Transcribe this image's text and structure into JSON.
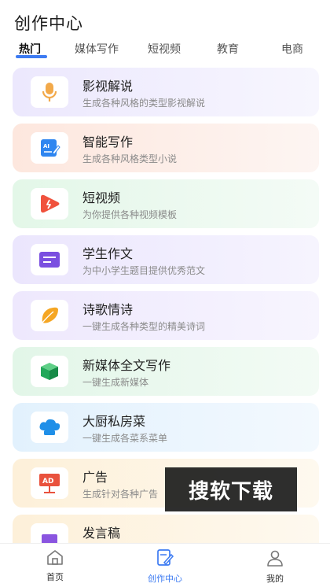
{
  "header": {
    "title": "创作中心"
  },
  "tabs": [
    {
      "label": "热门",
      "active": true
    },
    {
      "label": "媒体写作",
      "active": false
    },
    {
      "label": "短视频",
      "active": false
    },
    {
      "label": "教育",
      "active": false
    },
    {
      "label": "电商",
      "active": false
    }
  ],
  "cards": [
    {
      "title": "影视解说",
      "subtitle": "生成各种风格的类型影视解说",
      "icon": "microphone-icon",
      "bg": "#f1eefd",
      "accent": "#f2a94a"
    },
    {
      "title": "智能写作",
      "subtitle": "生成各种风格类型小说",
      "icon": "ai-write-icon",
      "bg": "#fdeee7",
      "accent": "#2f86f0"
    },
    {
      "title": "短视频",
      "subtitle": "为你提供各种视频模板",
      "icon": "video-play-icon",
      "bg": "#e9f8ee",
      "accent": "#f0523d"
    },
    {
      "title": "学生作文",
      "subtitle": "为中小学生题目提供优秀范文",
      "icon": "essay-icon",
      "bg": "#efeafd",
      "accent": "#7a4fe0"
    },
    {
      "title": "诗歌情诗",
      "subtitle": "一键生成各种类型的精美诗词",
      "icon": "leaf-icon",
      "bg": "#f1ecfd",
      "accent": "#f5a623"
    },
    {
      "title": "新媒体全文写作",
      "subtitle": "一键生成新媒体",
      "icon": "cube-icon",
      "bg": "#e8f7ec",
      "accent": "#22a85a"
    },
    {
      "title": "大厨私房菜",
      "subtitle": "一键生成各菜系菜单",
      "icon": "chef-hat-icon",
      "bg": "#e8f4fd",
      "accent": "#1f8fe8"
    },
    {
      "title": "广告",
      "subtitle": "生成针对各种广告",
      "icon": "ad-sign-icon",
      "bg": "#fdf3e1",
      "accent": "#e9523d"
    },
    {
      "title": "发言稿",
      "subtitle": "",
      "icon": "speech-icon",
      "bg": "#fdf3e1",
      "accent": "#8a55e0"
    }
  ],
  "watermark": "搜软下载",
  "bottom_nav": [
    {
      "label": "首页",
      "icon": "home-icon",
      "active": false
    },
    {
      "label": "创作中心",
      "icon": "create-icon",
      "active": true
    },
    {
      "label": "我的",
      "icon": "profile-icon",
      "active": false
    }
  ],
  "colors": {
    "accent": "#3d7bf2"
  }
}
